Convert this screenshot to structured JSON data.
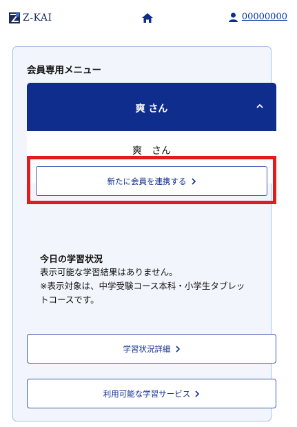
{
  "header": {
    "logo_text": "Z-KAI",
    "user_id": "00000000"
  },
  "menu": {
    "title": "会員専用メニュー",
    "member_name_header": "爽 さん",
    "member_name": "爽　さん",
    "link_button_label": "新たに会員を連携する"
  },
  "status": {
    "title": "今日の学習状況",
    "line1": "表示可能な学習結果はありません。",
    "line2": "※表示対象は、中学受験コース本科・小学生タブレッ",
    "line3": "トコースです。"
  },
  "buttons": {
    "detail_label": "学習状況詳細",
    "services_label": "利用可能な学習サービス"
  },
  "colors": {
    "primary_navy": "#0f2d8d",
    "highlight_red": "#e01c1c",
    "link_blue": "#0a35a6"
  }
}
